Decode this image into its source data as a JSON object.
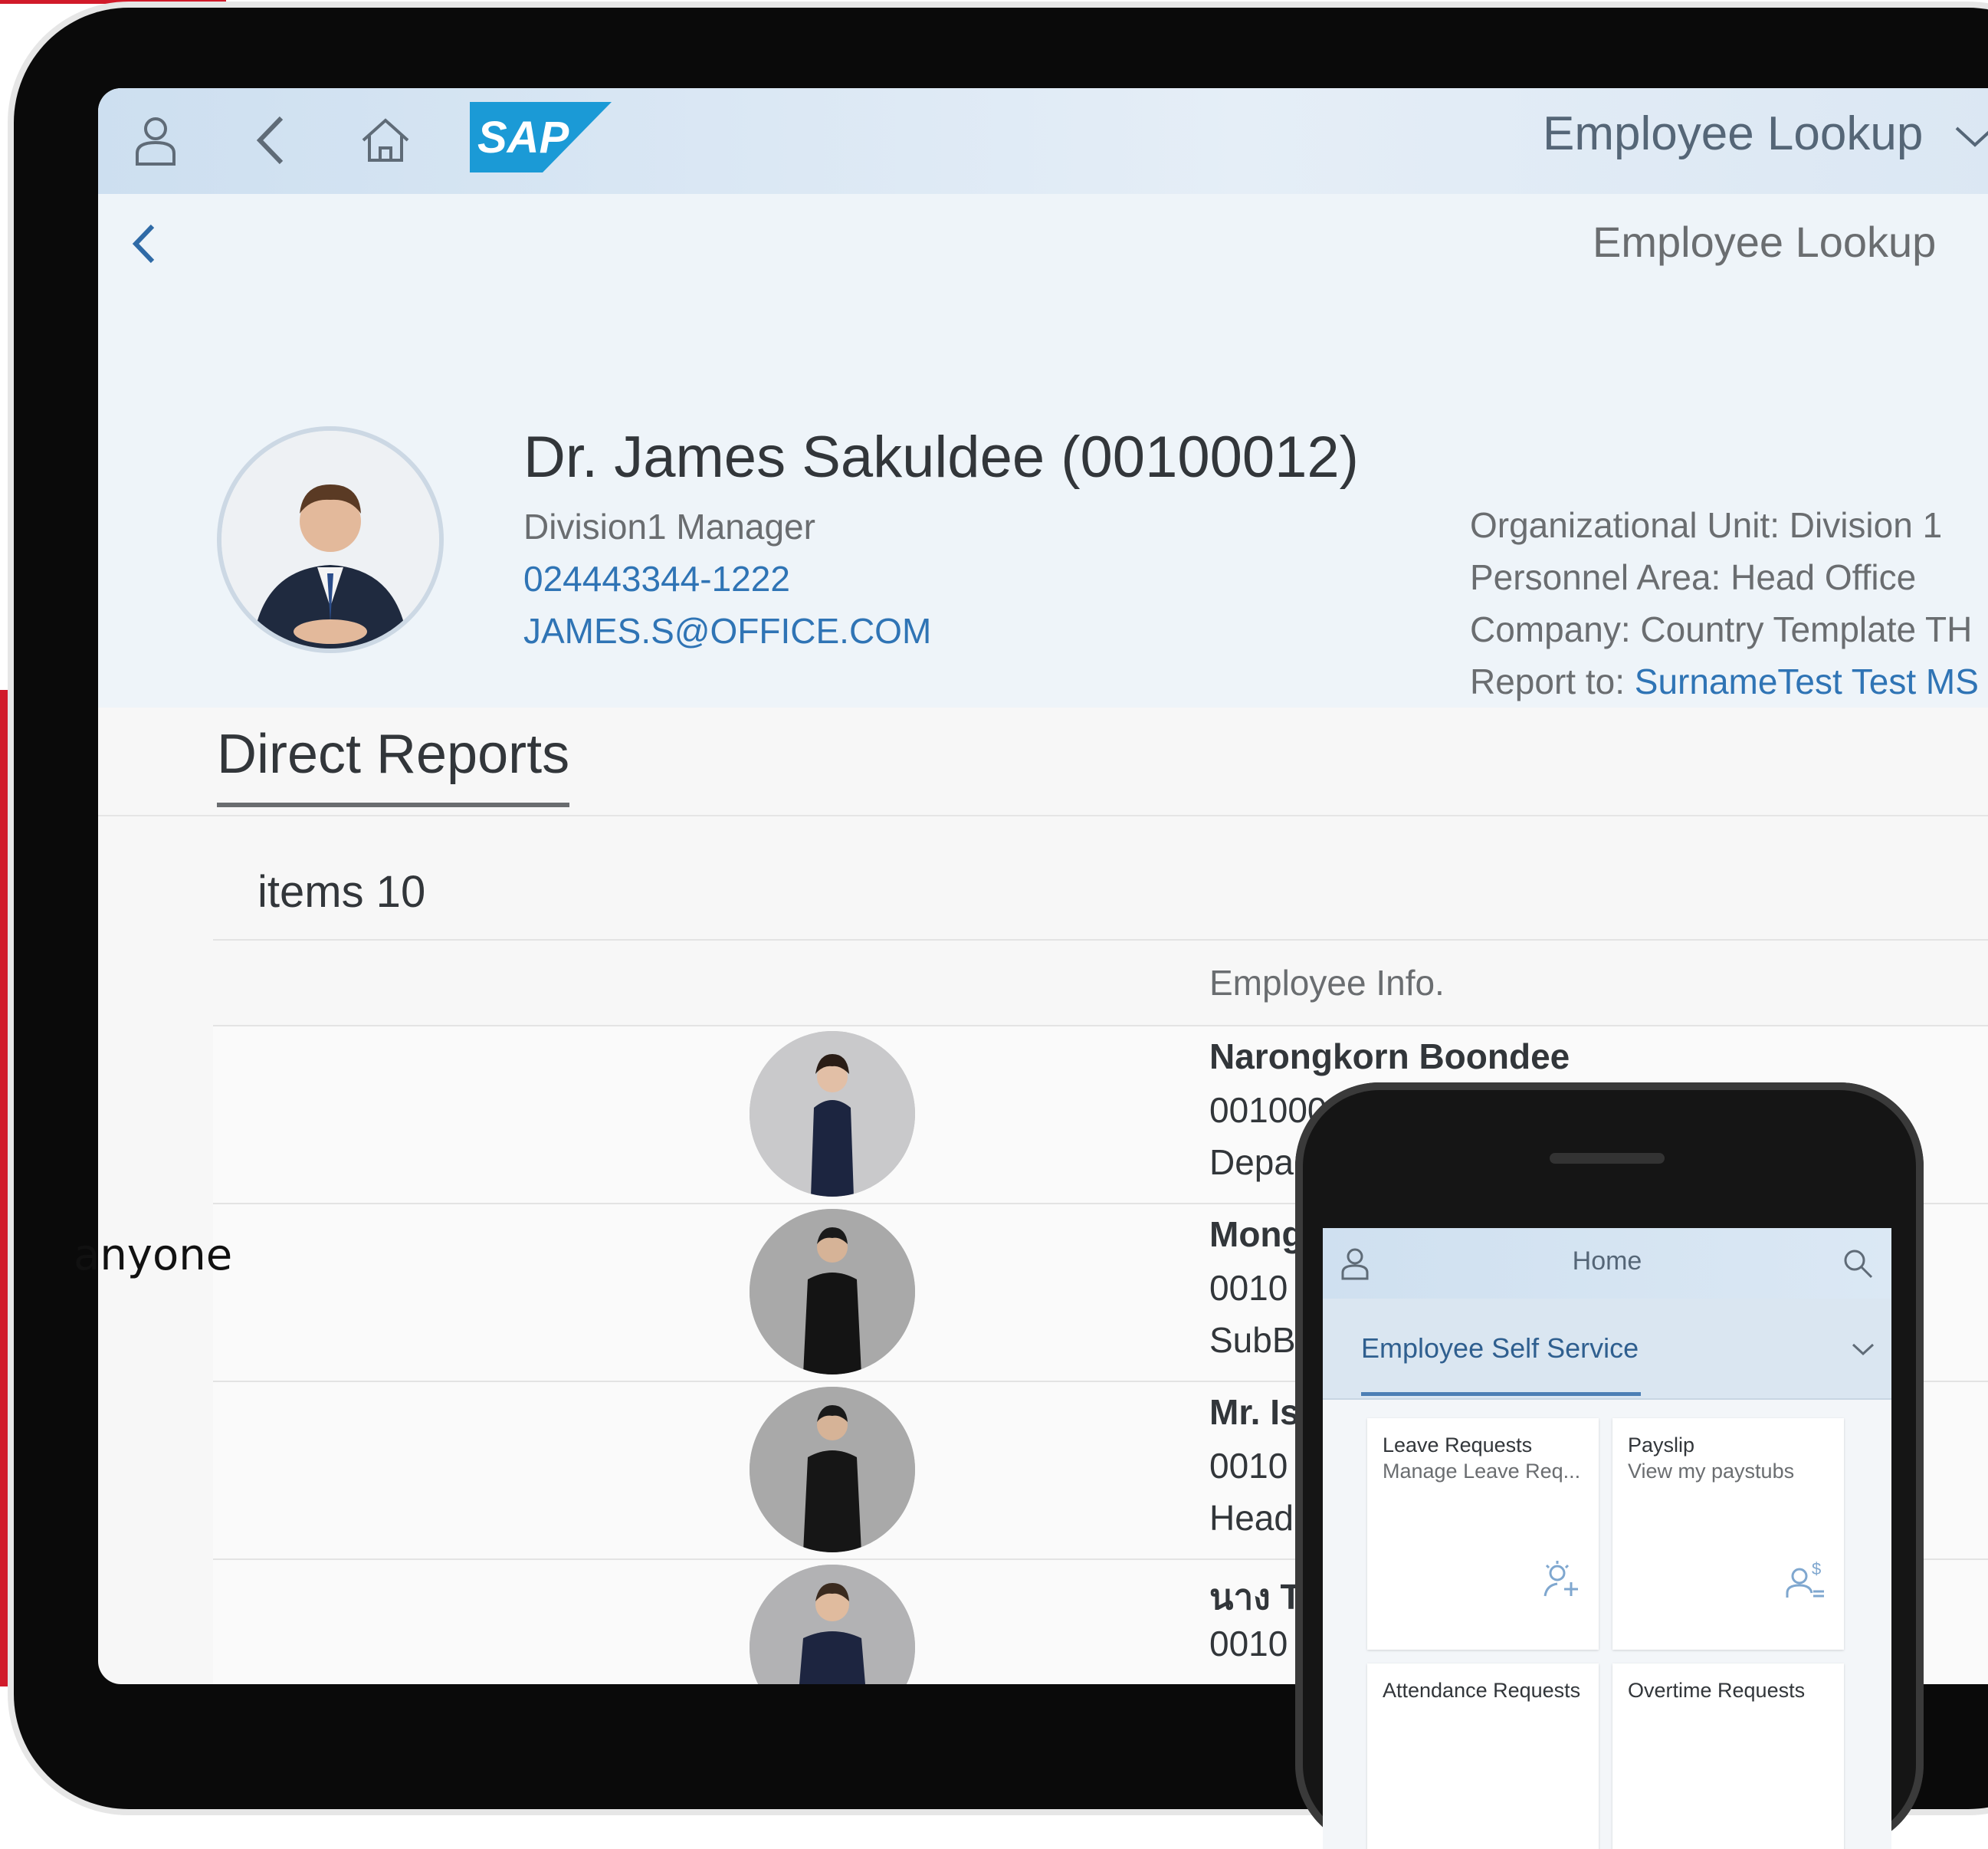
{
  "overlay": {
    "caption": "anyone"
  },
  "shellbar": {
    "logo_text": "SAP",
    "app_title": "Employee Lookup"
  },
  "subheader": {
    "title": "Employee Lookup"
  },
  "employee": {
    "name": "Dr. James Sakuldee (00100012)",
    "role": "Division1 Manager",
    "phone": "024443344-1222",
    "email": "JAMES.S@OFFICE.COM",
    "org_unit": "Organizational Unit: Division 1",
    "personnel_area": "Personnel Area: Head Office",
    "company": "Company: Country Template TH",
    "report_to_label": "Report to: ",
    "report_to_value": "SurnameTest Test MS"
  },
  "tabs": {
    "direct_reports": "Direct Reports"
  },
  "table": {
    "count_label": "items 10",
    "column_header": "Employee Info.",
    "rows": [
      {
        "name": "Narongkorn Boondee",
        "id": "001000",
        "dept": "Depa"
      },
      {
        "name": "Mong",
        "id": "0010",
        "dept": "SubB"
      },
      {
        "name": "Mr. Is",
        "id": "0010",
        "dept": "Head"
      },
      {
        "name": "นาง T",
        "id": "0010",
        "dept": ""
      }
    ]
  },
  "phone": {
    "home_title": "Home",
    "group_label": "Employee Self Service",
    "tiles": [
      {
        "title": "Leave Requests",
        "subtitle": "Manage Leave Req..."
      },
      {
        "title": "Payslip",
        "subtitle": "View my paystubs"
      },
      {
        "title": "Attendance Requests",
        "subtitle": ""
      },
      {
        "title": "Overtime Requests",
        "subtitle": ""
      }
    ]
  },
  "colors": {
    "brand_red": "#d11a2a",
    "shell_blue": "#cddff0",
    "link_blue": "#2f74b5",
    "sap_logo_blue": "#1b9ad6"
  }
}
